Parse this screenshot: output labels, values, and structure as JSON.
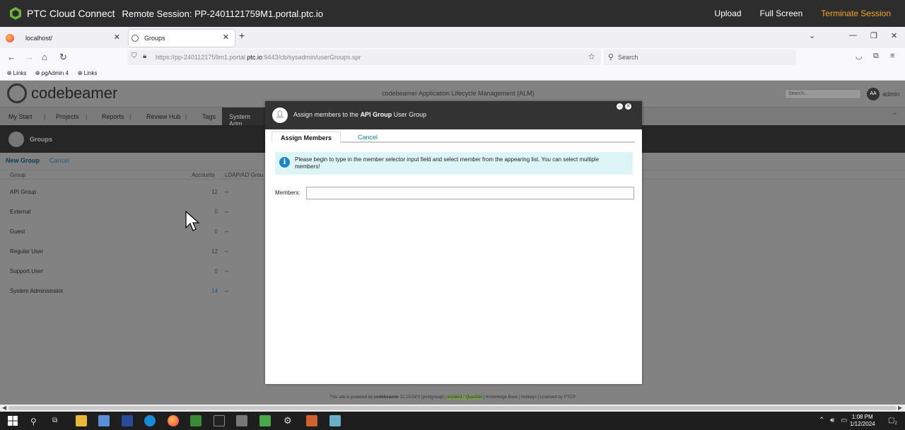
{
  "remote": {
    "app_title": "PTC Cloud Connect",
    "session": "Remote Session: PP-2401121759M1.portal.ptc.io",
    "upload": "Upload",
    "full_screen": "Full Screen",
    "terminate": "Terminate Session"
  },
  "browser": {
    "tabs": [
      {
        "label": "localhost/"
      },
      {
        "label": "Groups"
      }
    ],
    "url_prefix": "https://pp-2401121759m1.portal.",
    "url_domain": "ptc.io",
    "url_suffix": ":9443/cb/sysadmin/userGroups.spr",
    "search_placeholder": "Search",
    "bookmarks": [
      "Links",
      "pgAdmin 4",
      "Links"
    ]
  },
  "codebeamer": {
    "logo": "codebeamer",
    "header_center": "codebeamer Application Lifecycle Management (ALM)",
    "search_placeholder": "Search...",
    "avatar_initials": "AA",
    "user": "admin",
    "menu": [
      "My Start",
      "Projects",
      "Reports",
      "Review Hub",
      "Tags",
      "System Adm"
    ],
    "page_title": "Groups",
    "actions": {
      "new_group": "New Group",
      "cancel": "Cancel"
    },
    "table": {
      "headers": {
        "group": "Group",
        "accounts": "Accounts",
        "ldap": "LDAP/AD Grou"
      },
      "rows": [
        {
          "name": "API Group",
          "accounts": "12",
          "ldap": "--"
        },
        {
          "name": "External",
          "accounts": "0",
          "ldap": "--"
        },
        {
          "name": "Guest",
          "accounts": "0",
          "ldap": "--"
        },
        {
          "name": "Regular User",
          "accounts": "12",
          "ldap": "--"
        },
        {
          "name": "Support User",
          "accounts": "0",
          "ldap": "--"
        },
        {
          "name": "System Administrator",
          "accounts": "14",
          "ldap": "--"
        }
      ]
    },
    "footer": {
      "text1": "This site is powered by",
      "brand": "codebeamer",
      "version": "22.10-SP3 (postgresql) |",
      "incident": "Incident / Question",
      "rest": "| Knowledge Base | Hotkeys | Licensed by PTC®"
    }
  },
  "dialog": {
    "title_pre": "Assign members to the",
    "title_group": "API Group",
    "title_post": "User Group",
    "tab_assign": "Assign Members",
    "tab_cancel": "Cancel",
    "info": "Please begin to type in the member selector input field and select member from the appearing list. You can select multiple members!",
    "members_label": "Members:",
    "members_value": ""
  },
  "taskbar": {
    "time": "1:08 PM",
    "date": "1/12/2024",
    "notifications": "2"
  }
}
